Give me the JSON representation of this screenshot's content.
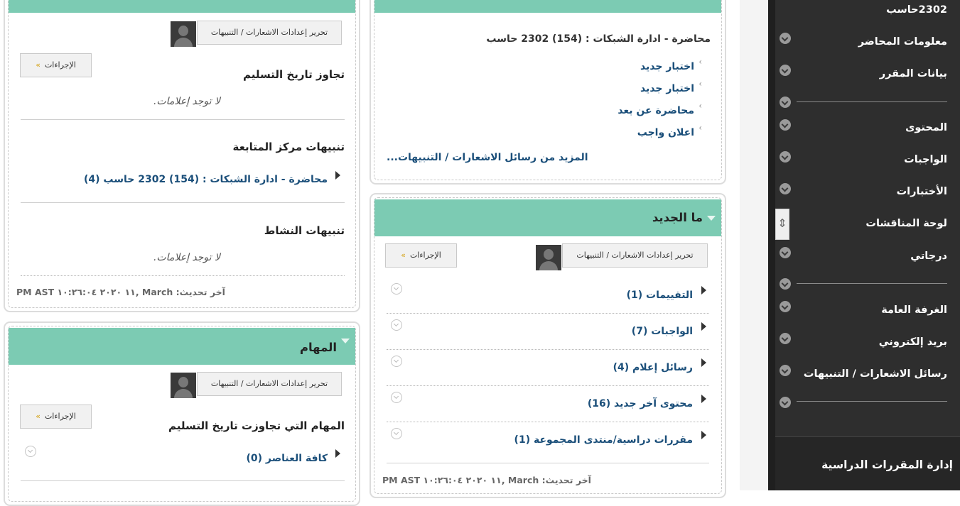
{
  "sidebar": {
    "course_name": "2302حاسب",
    "items": [
      {
        "label": "معلومات المحاضر"
      },
      {
        "label": "بيانات المقرر"
      },
      {
        "label": "المحتوى"
      },
      {
        "label": "الواجبات"
      },
      {
        "label": "الأختبارات"
      },
      {
        "label": "لوحة المناقشات"
      },
      {
        "label": "درجاتي"
      },
      {
        "label": "الغرفة العامة"
      },
      {
        "label": "بريد إلكتروني"
      },
      {
        "label": "رسائل الاشعارات / التنبيهات"
      }
    ],
    "management": "إدارة المقررات الدراسية"
  },
  "announcements": {
    "course_line": "محاضرة - ادارة الشبكات : (154) 2302 حاسب",
    "links": [
      "اختبار جديد",
      "اختبار جديد",
      "محاضرة عن بعد",
      "اعلان واجب"
    ],
    "more": "المزيد من رسائل الاشعارات / التنبيهات..."
  },
  "whats_new": {
    "title": "ما الجديد",
    "edit_button": "تحرير إعدادات الاشعارات / التنبيهات",
    "actions_button": "الإجراءات",
    "items": [
      {
        "label": "التقييمات",
        "count": "(1)"
      },
      {
        "label": "الواجبات",
        "count": "(7)"
      },
      {
        "label": "رسائل إعلام",
        "count": "(4)"
      },
      {
        "label": "محتوى آخر جديد",
        "count": "(16)"
      },
      {
        "label": "مقررات دراسية/منتدى المجموعة",
        "count": "(1)"
      }
    ],
    "updated": "آخر تحديث: March ,١١ ٢٠٢٠ ١٠:٢٦:٠٤ PM AST"
  },
  "alerts": {
    "edit_button": "تحرير إعدادات الاشعارات / التنبيهات",
    "actions_button": "الإجراءات",
    "past_due": "تجاوز تاريخ التسليم",
    "no_alerts_1": "لا توجد إعلامات.",
    "retention": "تنبيهات مركز المتابعة",
    "retention_item": "محاضرة - ادارة الشبكات : (154) 2302 حاسب (4)",
    "activity": "تنبيهات النشاط",
    "no_alerts_2": "لا توجد إعلامات.",
    "updated": "آخر تحديث: March ,١١ ٢٠٢٠ ١٠:٢٦:٠٤ PM AST"
  },
  "tasks": {
    "title": "المهام",
    "edit_button": "تحرير إعدادات الاشعارات / التنبيهات",
    "actions_button": "الإجراءات",
    "overdue": "المهام التي تجاوزت تاريخ التسليم",
    "all_items": "كافة العناصر (0)"
  },
  "colors": {
    "header_green": "#7ccbb3",
    "sidebar_dark": "#2e2e2e",
    "link_blue": "#1b4f7a"
  }
}
